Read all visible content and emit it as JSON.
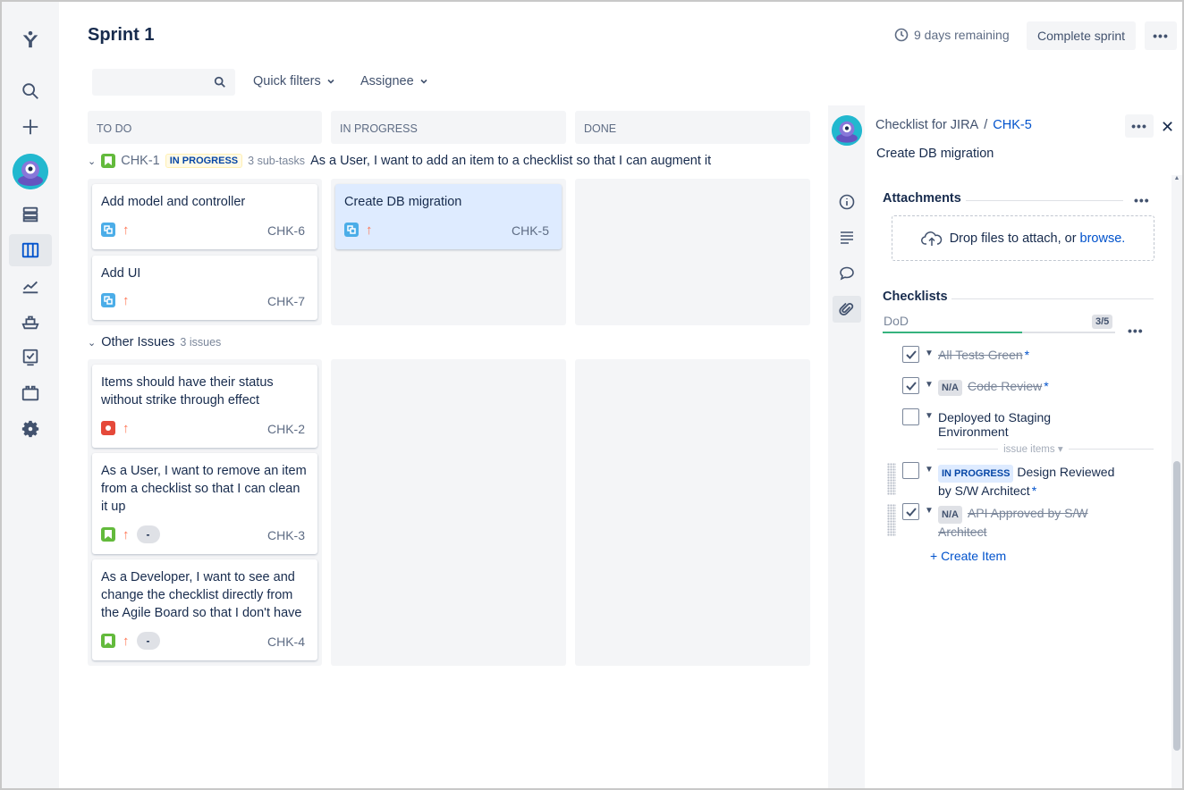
{
  "header": {
    "title": "Sprint 1",
    "days_remaining": "9 days remaining",
    "complete_label": "Complete sprint",
    "more_label": "•••"
  },
  "filters": {
    "search_value": "",
    "search_placeholder": "",
    "quick_filters": "Quick filters",
    "assignee": "Assignee"
  },
  "columns": [
    "TO DO",
    "IN PROGRESS",
    "DONE"
  ],
  "swimlanes": {
    "parent": {
      "key": "CHK-1",
      "status": "IN PROGRESS",
      "subtasks": "3 sub-tasks",
      "summary": "As a User, I want to add an item to a checklist so that I can augment it"
    },
    "other": {
      "label": "Other Issues",
      "count": "3 issues"
    }
  },
  "cards": {
    "chk6": {
      "summary": "Add model and controller",
      "key": "CHK-6"
    },
    "chk7": {
      "summary": "Add UI",
      "key": "CHK-7"
    },
    "chk5": {
      "summary": "Create DB migration",
      "key": "CHK-5"
    },
    "chk2": {
      "summary": "Items should have their status without strike through effect",
      "key": "CHK-2"
    },
    "chk3": {
      "summary": "As a User, I want to remove an item from a checklist so that I can clean it up",
      "key": "CHK-3",
      "estimate": "-"
    },
    "chk4": {
      "summary": "As a Developer, I want to see and change the checklist directly from the Agile Board so that I don't have",
      "key": "CHK-4",
      "estimate": "-"
    }
  },
  "detail": {
    "project": "Checklist for JIRA",
    "separator": "/",
    "issue_key": "CHK-5",
    "summary": "Create DB migration",
    "more_label": "•••",
    "close_label": "✕",
    "attachments": {
      "title": "Attachments",
      "drop_text": "Drop files to attach, or",
      "browse": "browse."
    },
    "checklists": {
      "title": "Checklists",
      "name": "DoD",
      "count": "3/5",
      "progress": 0.6,
      "items": [
        {
          "text": "All Tests Green",
          "checked": true,
          "star": "*"
        },
        {
          "text": "Code Review",
          "checked": true,
          "na": "N/A",
          "star": "*"
        },
        {
          "text": "Deployed to Staging Environment",
          "checked": false
        },
        {
          "text": "Design Reviewed by S/W Architect",
          "checked": false,
          "status": "IN PROGRESS",
          "star": "*"
        },
        {
          "text": "API Approved by S/W Architect",
          "checked": true,
          "na": "N/A"
        }
      ],
      "issue_items_label": "issue items ▾",
      "create_item": "+ Create Item"
    }
  },
  "colors": {
    "accent": "#0052cc",
    "story": "#63ba3c",
    "subtask": "#4bade8",
    "bug": "#e5493a",
    "priority": "#ff7452"
  }
}
